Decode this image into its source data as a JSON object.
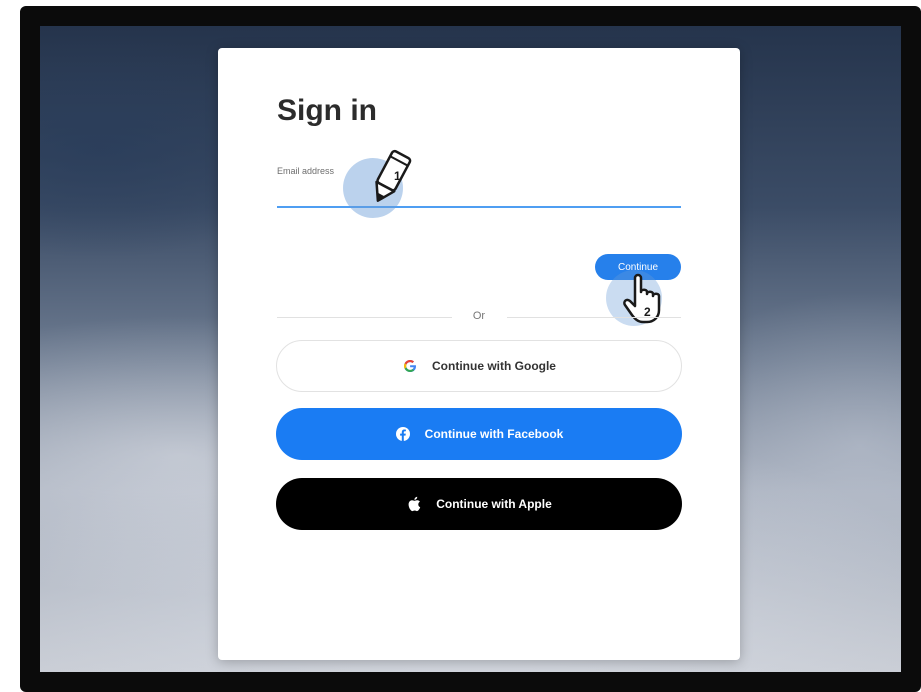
{
  "signin": {
    "title": "Sign in",
    "email_label": "Email address",
    "email_value": "",
    "continue_label": "Continue",
    "divider_text": "Or",
    "google_label": "Continue with Google",
    "facebook_label": "Continue with Facebook",
    "apple_label": "Continue with Apple"
  },
  "annotations": {
    "step1_number": "1",
    "step2_number": "2"
  },
  "icons": {
    "google": "google-g-icon",
    "facebook": "facebook-icon",
    "apple": "apple-icon",
    "pencil": "pencil-pointer-icon",
    "hand": "hand-pointer-icon"
  },
  "colors": {
    "accent": "#2680eb",
    "facebook": "#1a7cf3",
    "apple": "#000000",
    "input_underline": "#4f9ef2"
  }
}
